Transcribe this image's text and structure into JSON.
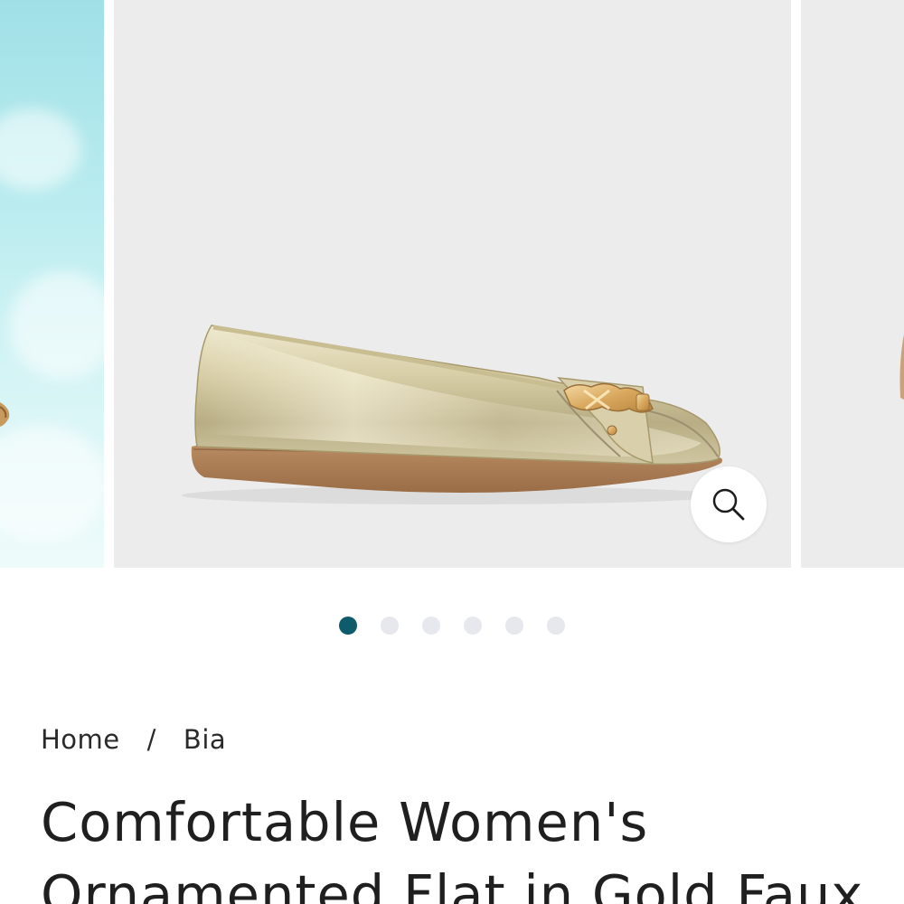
{
  "carousel": {
    "slide_count": 6,
    "active_index": 0,
    "accent_color": "#0e5b6b",
    "inactive_dot_color": "#e7e8ee",
    "zoom_icon": "magnifier-icon"
  },
  "breadcrumb": {
    "home": "Home",
    "separator": "/",
    "current": "Bia"
  },
  "product": {
    "title": "Comfortable Women's Ornamented Flat in Gold Faux"
  }
}
